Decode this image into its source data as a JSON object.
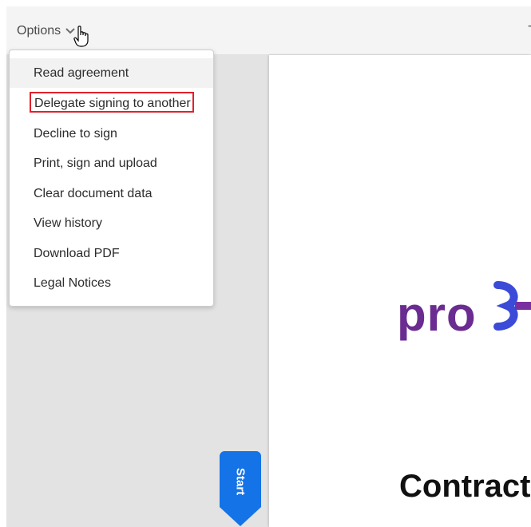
{
  "topbar": {
    "options_label": "Options",
    "right_text": "T"
  },
  "menu": {
    "items": [
      {
        "label": "Read agreement"
      },
      {
        "label": "Delegate signing to another"
      },
      {
        "label": "Decline to sign"
      },
      {
        "label": "Print, sign and upload"
      },
      {
        "label": "Clear document data"
      },
      {
        "label": "View history"
      },
      {
        "label": "Download PDF"
      },
      {
        "label": "Legal Notices"
      }
    ]
  },
  "document": {
    "logo_text": "pro",
    "title_partial": "Contract"
  },
  "start_flag": {
    "label": "Start",
    "color": "#1473e6"
  },
  "colors": {
    "logo": "#6a2c91",
    "highlight": "#e0212b"
  }
}
